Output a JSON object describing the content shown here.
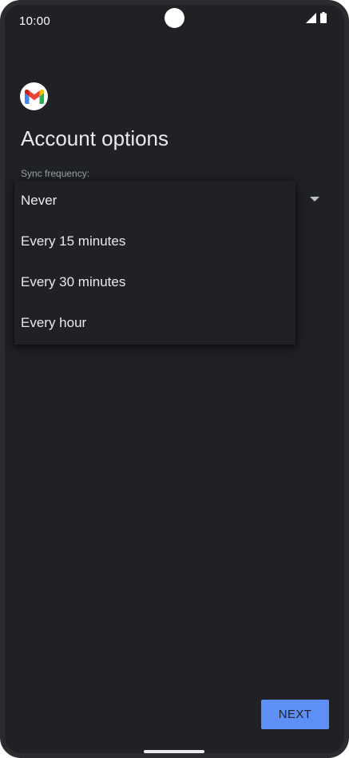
{
  "status_bar": {
    "time": "10:00",
    "icons": [
      "signal-icon",
      "battery-icon"
    ]
  },
  "app": {
    "logo": "gmail-logo",
    "title": "Account options"
  },
  "sync": {
    "label": "Sync frequency:",
    "options": [
      "Never",
      "Every 15 minutes",
      "Every 30 minutes",
      "Every hour"
    ]
  },
  "actions": {
    "next_label": "NEXT"
  },
  "colors": {
    "background": "#202124",
    "text": "#e8eaed",
    "accent": "#5e8ff5"
  }
}
